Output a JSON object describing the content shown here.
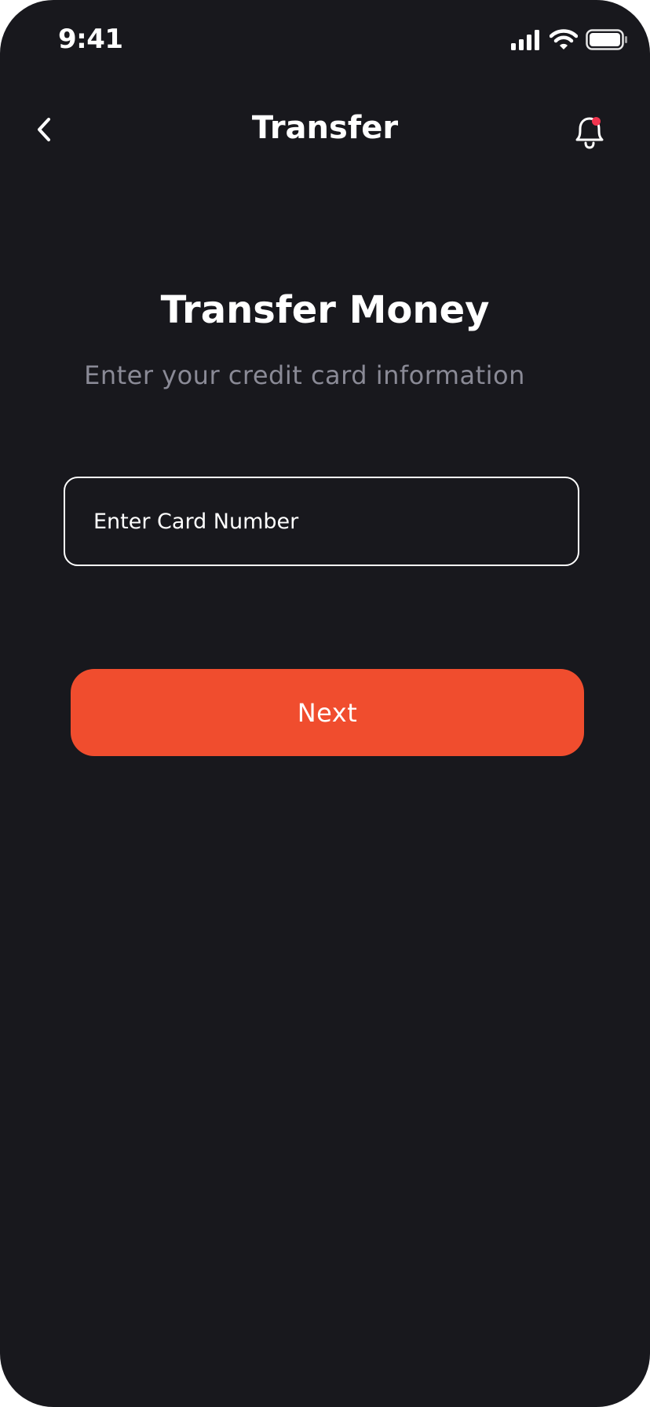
{
  "status_bar": {
    "time": "9:41"
  },
  "header": {
    "title": "Transfer",
    "back_icon": "chevron-left-icon",
    "notification_icon": "bell-icon",
    "has_unread_notification": true
  },
  "main": {
    "title": "Transfer Money",
    "subtitle": "Enter your credit card information",
    "card_input": {
      "placeholder": "Enter Card Number",
      "value": ""
    },
    "next_button_label": "Next"
  },
  "colors": {
    "background": "#18181d",
    "accent": "#f04d2e",
    "notification_dot": "#f0344f",
    "muted_text": "#8a8a96"
  }
}
